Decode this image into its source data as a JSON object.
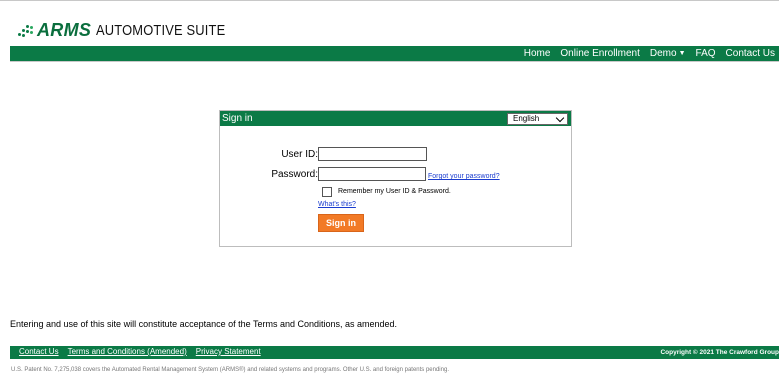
{
  "logo": {
    "brand": "ARMS",
    "suite": "AUTOMOTIVE SUITE"
  },
  "nav": {
    "items": [
      "Home",
      "Online Enrollment",
      "Demo",
      "FAQ",
      "Contact Us"
    ]
  },
  "signin": {
    "title": "Sign in",
    "language": "English",
    "userid_label": "User ID:",
    "password_label": "Password:",
    "userid_value": "",
    "password_value": "",
    "forgot_link": "Forgot your password?",
    "remember_label": "Remember my User ID & Password.",
    "whats_this": "What's this?",
    "button": "Sign in"
  },
  "terms_note": "Entering and use of this site will constitute acceptance of the Terms and Conditions, as amended.",
  "footer": {
    "links": [
      "Contact Us",
      "Terms and Conditions (Amended)",
      "Privacy Statement"
    ],
    "copyright": "Copyright © 2021 The Crawford Group"
  },
  "patent": "U.S. Patent No. 7,275,038 covers the Automated Rental Management System (ARMS®) and related systems and programs. Other U.S. and foreign patents pending.",
  "colors": {
    "brand_green": "#0b7a46",
    "button_orange": "#f27a26",
    "link_blue": "#1a3ccf"
  }
}
